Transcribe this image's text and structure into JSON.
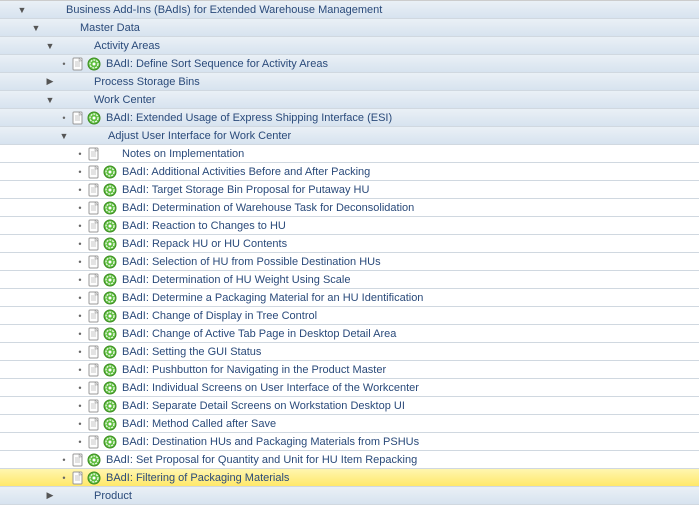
{
  "tree": {
    "root": "Business Add-Ins (BAdIs) for Extended Warehouse Management",
    "master_data": "Master Data",
    "activity_areas": "Activity Areas",
    "define_sort": "BAdI: Define Sort Sequence for Activity Areas",
    "process_bins": "Process Storage Bins",
    "work_center": "Work Center",
    "esi": "BAdI: Extended Usage of Express Shipping Interface (ESI)",
    "adjust_ui": "Adjust User Interface for Work Center",
    "notes": "Notes on Implementation",
    "badi": {
      "b1": "BAdI: Additional Activities Before and After Packing",
      "b2": "BAdI: Target Storage Bin Proposal for Putaway HU",
      "b3": "BAdI: Determination of Warehouse Task for Deconsolidation",
      "b4": "BAdI: Reaction to Changes to HU",
      "b5": "BAdI: Repack HU or HU Contents",
      "b6": "BAdI: Selection of HU from Possible Destination HUs",
      "b7": "BAdI: Determination of HU Weight Using Scale",
      "b8": "BAdI: Determine a Packaging Material for an HU Identification",
      "b9": "BAdI: Change of Display in Tree Control",
      "b10": "BAdI: Change of Active Tab Page in Desktop Detail Area",
      "b11": "BAdI: Setting the GUI Status",
      "b12": "BAdI: Pushbutton for Navigating in the Product Master",
      "b13": "BAdI: Individual Screens on User Interface of the Workcenter",
      "b14": "BAdI: Separate Detail Screens on Workstation Desktop UI",
      "b15": "BAdI: Method Called after Save",
      "b16": "BAdI: Destination HUs and Packaging Materials from PSHUs"
    },
    "set_proposal": "BAdI: Set Proposal for Quantity and Unit for HU Item Repacking",
    "filtering": "BAdI: Filtering of Packaging Materials",
    "product": "Product"
  }
}
